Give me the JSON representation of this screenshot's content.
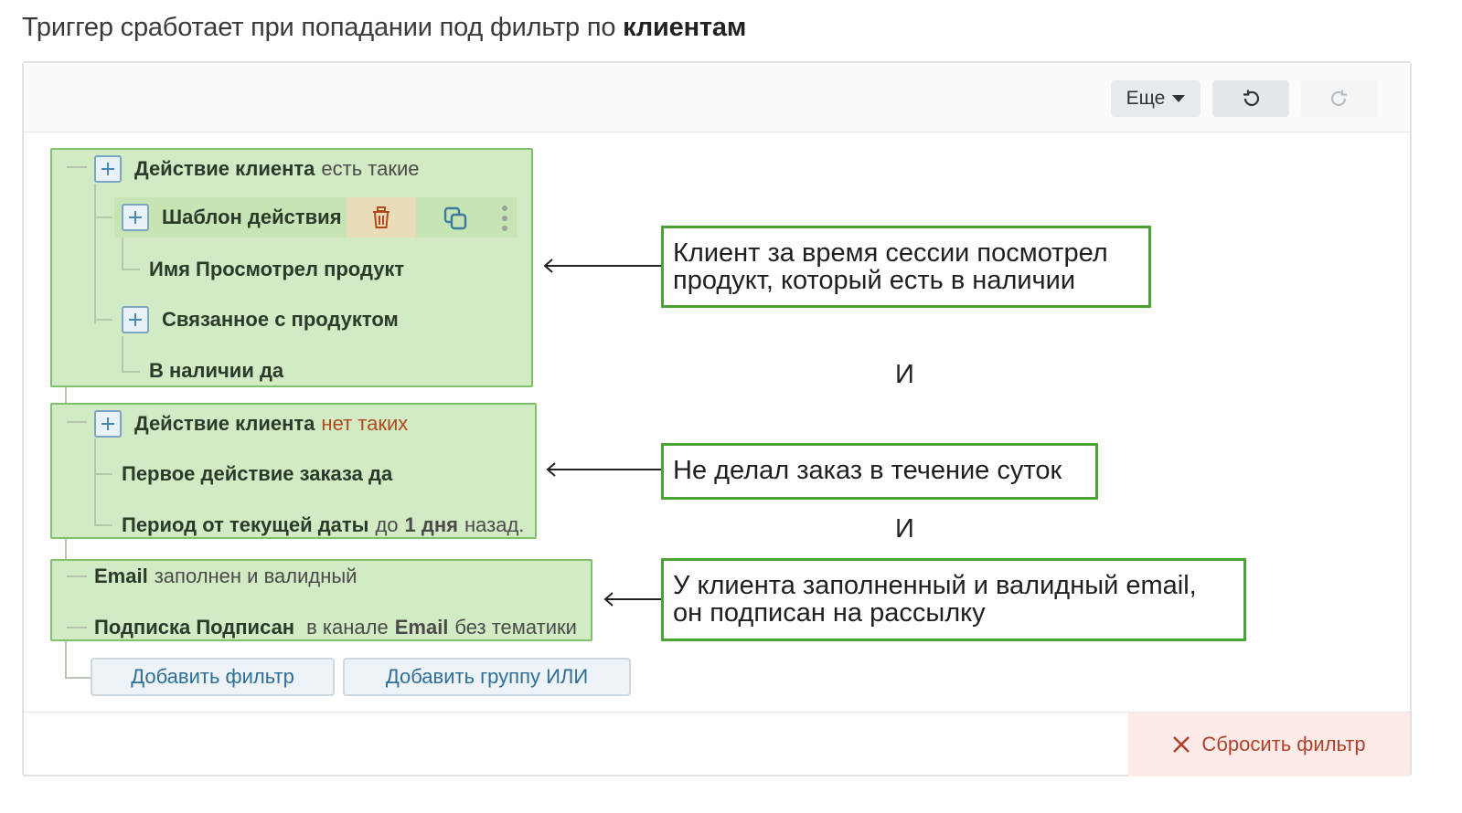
{
  "heading": {
    "prefix": "Триггер сработает при попадании под фильтр по",
    "bold": "клиентам"
  },
  "toolbar": {
    "more_label": "Еще",
    "undo_icon": "undo-icon",
    "redo_icon": "redo-icon"
  },
  "groups": [
    {
      "rows": [
        {
          "bold": "Действие клиента",
          "text": "есть такие"
        },
        {
          "bold": "Шаблон действия"
        },
        {
          "bold": "Имя Просмотрел продукт"
        },
        {
          "bold": "Связанное с продуктом"
        },
        {
          "bold": "В наличии да"
        }
      ]
    },
    {
      "rows": [
        {
          "bold": "Действие клиента",
          "text": "нет таких"
        },
        {
          "bold": "Первое действие заказа да"
        },
        {
          "bold": "Период от текущей даты",
          "text1": "до",
          "bold2": "1 дня",
          "text2": "назад."
        }
      ]
    },
    {
      "rows": [
        {
          "bold": "Email",
          "text": "заполнен и валидный"
        },
        {
          "bold": "Подписка Подписан",
          "text1": "в канале",
          "bold2": "Email",
          "text2": "без тематики"
        }
      ]
    }
  ],
  "buttons": {
    "add_filter": "Добавить фильтр",
    "add_or_group": "Добавить группу ИЛИ",
    "reset_filter": "Сбросить фильтр"
  },
  "annotations": {
    "note1": {
      "line1": "Клиент за время сессии посмотрел",
      "line2": "продукт, который есть в наличии"
    },
    "and1": "И",
    "note2": {
      "line1": "Не делал заказ в течение суток"
    },
    "and2": "И",
    "note3": {
      "line1": "У клиента заполненный и валидный email,",
      "line2": "он подписан на рассылку"
    }
  },
  "colors": {
    "group_fill": "#d3ebc5",
    "group_border": "#7fc26a",
    "note_border": "#4ba336",
    "accent_blue": "#2e6f99",
    "danger": "#b1412a"
  }
}
